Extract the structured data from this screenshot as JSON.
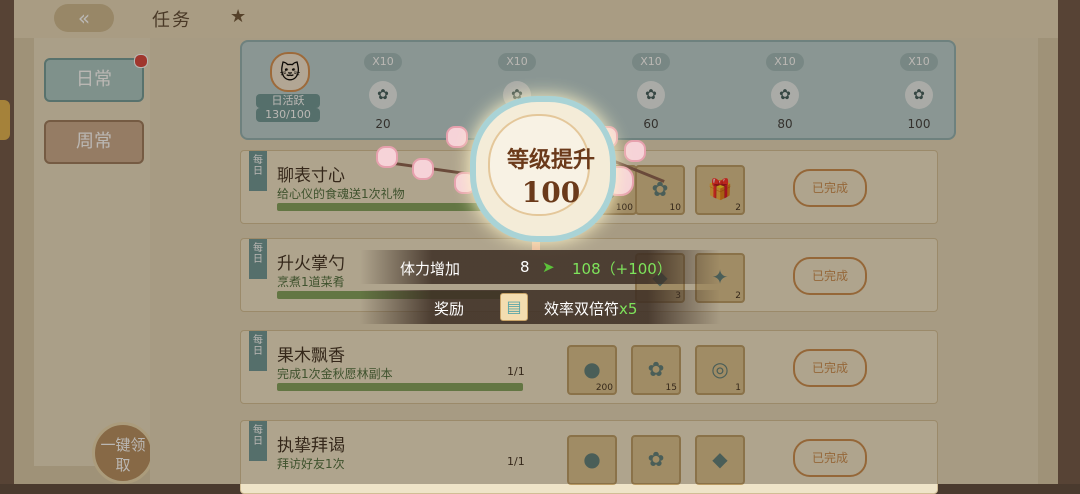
{
  "header": {
    "back_symbol": "«",
    "title": "任务",
    "star_symbol": "★"
  },
  "sidebar": {
    "tabs": [
      {
        "label": "日常"
      },
      {
        "label": "周常"
      }
    ],
    "claim_all": "一键领取"
  },
  "activity": {
    "label": "日活跃",
    "count": "130/100",
    "milestones": [
      {
        "chip": "X10",
        "value": "20"
      },
      {
        "chip": "X10",
        "value": ""
      },
      {
        "chip": "X10",
        "value": "60"
      },
      {
        "chip": "X10",
        "value": "80"
      },
      {
        "chip": "X10",
        "value": "100"
      }
    ]
  },
  "tasks": [
    {
      "tag": "每日",
      "name": "聊表寸心",
      "desc": "给心仪的食魂送1次礼物",
      "progress": "",
      "rewards": [
        {
          "glyph": "◆",
          "qty": "100"
        },
        {
          "glyph": "✿",
          "qty": "10"
        },
        {
          "glyph": "🎁",
          "qty": "2"
        }
      ],
      "status": "已完成"
    },
    {
      "tag": "每日",
      "name": "升火掌勺",
      "desc": "烹煮1道菜肴",
      "progress": "",
      "rewards": [
        {
          "glyph": "◆",
          "qty": "3"
        },
        {
          "glyph": "✦",
          "qty": "2"
        }
      ],
      "status": "已完成"
    },
    {
      "tag": "每日",
      "name": "果木飘香",
      "desc": "完成1次金秋愿林副本",
      "progress": "1/1",
      "rewards": [
        {
          "glyph": "●",
          "qty": "200"
        },
        {
          "glyph": "✿",
          "qty": "15"
        },
        {
          "glyph": "◎",
          "qty": "1"
        }
      ],
      "status": "已完成"
    },
    {
      "tag": "每日",
      "name": "执挚拜谒",
      "desc": "拜访好友1次",
      "progress": "1/1",
      "rewards": [
        {
          "glyph": "●",
          "qty": ""
        },
        {
          "glyph": "✿",
          "qty": ""
        },
        {
          "glyph": "◆",
          "qty": ""
        }
      ],
      "status": "已完成"
    }
  ],
  "popup": {
    "title": "等级提升",
    "level": "100",
    "stat_label": "体力增加",
    "stat_old": "8",
    "arrow": "➤",
    "stat_new": "108（+100）",
    "reward_label": "奖励",
    "reward_icon": "▤",
    "reward_name": "效率双倍符",
    "reward_mult": "x5"
  },
  "colors": {
    "accent_teal": "#6b9596",
    "gain_green": "#7ee35b",
    "medal_brown": "#6b3a1a"
  }
}
